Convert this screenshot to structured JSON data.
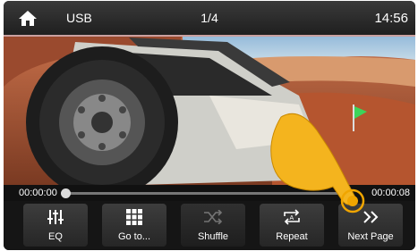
{
  "topbar": {
    "home_icon": "home-icon",
    "source": "USB",
    "track": "1/4",
    "clock": "14:56"
  },
  "playback": {
    "elapsed": "00:00:00",
    "total": "00:00:08",
    "progress": 0.0
  },
  "controls": [
    {
      "label": "EQ",
      "icon": "equalizer-icon"
    },
    {
      "label": "Go to...",
      "icon": "grid-icon"
    },
    {
      "label": "Shuffle",
      "icon": "shuffle-icon",
      "disabled": true
    },
    {
      "label": "Repeat",
      "icon": "repeat-icon"
    },
    {
      "label": "Next Page",
      "icon": "double-chevron-right-icon"
    }
  ],
  "colors": {
    "hand": "#f4b41e",
    "highlight": "#f0a500"
  }
}
